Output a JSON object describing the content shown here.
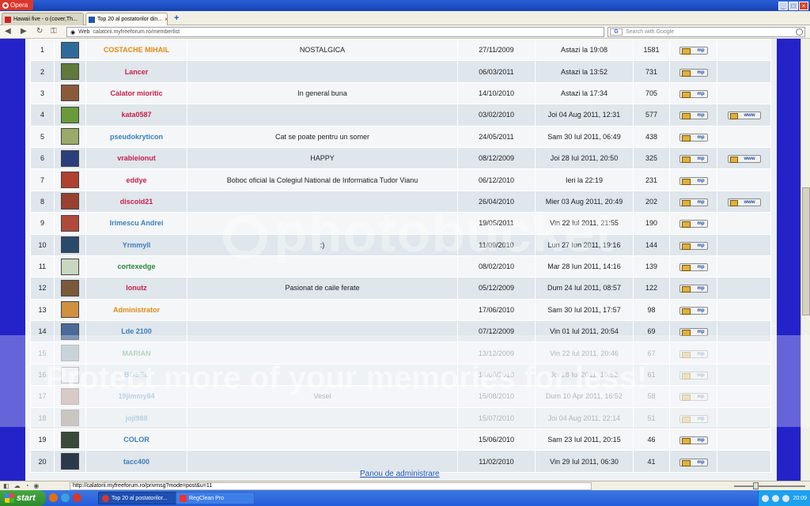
{
  "window": {
    "menu_label": "Opera",
    "minimize": "_",
    "maximize": "□",
    "close": "×"
  },
  "tabs": [
    {
      "label": "Hawaii five - o (cover,Th...",
      "fav_color": "#cc2222"
    },
    {
      "label": "Top 20 al postatorilor din...",
      "fav_color": "#2255aa"
    }
  ],
  "tab_close": "×",
  "new_tab": "+",
  "address": {
    "web_label": "Web",
    "url": "calatorii.myfreeforum.ro/memberlist"
  },
  "search": {
    "engine": "G",
    "placeholder": "Search with Google"
  },
  "rows": [
    {
      "rank": "1",
      "username": "COSTACHE MIHAIL",
      "color": "#e08a16",
      "motto": "NOSTALGICA",
      "joined": "27/11/2009",
      "last_visit": "Astazi la 19:08",
      "posts": "1581",
      "www": false,
      "faded": false,
      "avatar": "#2f6b9a"
    },
    {
      "rank": "2",
      "username": "Lancer",
      "color": "#c8204a",
      "motto": "",
      "joined": "06/03/2011",
      "last_visit": "Astazi la 13:52",
      "posts": "731",
      "www": false,
      "faded": false,
      "avatar": "#5f7a3a"
    },
    {
      "rank": "3",
      "username": "Calator mioritic",
      "color": "#c8204a",
      "motto": "In general buna",
      "joined": "14/10/2010",
      "last_visit": "Astazi la 17:34",
      "posts": "705",
      "www": false,
      "faded": false,
      "avatar": "#8a5a3a"
    },
    {
      "rank": "4",
      "username": "kata0587",
      "color": "#c8204a",
      "motto": "",
      "joined": "03/02/2010",
      "last_visit": "Joi 04 Aug 2011, 12:31",
      "posts": "577",
      "www": true,
      "faded": false,
      "avatar": "#6a9a3a"
    },
    {
      "rank": "5",
      "username": "pseudokryticon",
      "color": "#3a7fb8",
      "motto": "Cat se poate pentru un somer",
      "joined": "24/05/2011",
      "last_visit": "Sam 30 Iul 2011, 06:49",
      "posts": "438",
      "www": false,
      "faded": false,
      "avatar": "#9aaa6a"
    },
    {
      "rank": "6",
      "username": "vrabieionut",
      "color": "#c8204a",
      "motto": "HAPPY",
      "joined": "08/12/2009",
      "last_visit": "Joi 28 Iul 2011, 20:50",
      "posts": "325",
      "www": true,
      "faded": false,
      "avatar": "#2a3f7a"
    },
    {
      "rank": "7",
      "username": "eddye",
      "color": "#c8204a",
      "motto": "Boboc oficial la Colegiul National de Informatica Tudor Vianu",
      "joined": "06/12/2010",
      "last_visit": "Ieri la 22:19",
      "posts": "231",
      "www": false,
      "faded": false,
      "avatar": "#b04030"
    },
    {
      "rank": "8",
      "username": "discoid21",
      "color": "#c8204a",
      "motto": "",
      "joined": "26/04/2010",
      "last_visit": "Mier 03 Aug 2011, 20:49",
      "posts": "202",
      "www": true,
      "faded": false,
      "avatar": "#9a4030"
    },
    {
      "rank": "9",
      "username": "Irimescu Andrei",
      "color": "#3a7fb8",
      "motto": "",
      "joined": "19/05/2011",
      "last_visit": "Vin 22 Iul 2011, 21:55",
      "posts": "190",
      "www": false,
      "faded": false,
      "avatar": "#b04a3a"
    },
    {
      "rank": "10",
      "username": "Yrmmyll",
      "color": "#3a7fb8",
      "motto": ":)",
      "joined": "11/09/2010",
      "last_visit": "Lun 27 Iun 2011, 19:16",
      "posts": "144",
      "www": false,
      "faded": false,
      "avatar": "#2a4a6a"
    },
    {
      "rank": "11",
      "username": "cortexedge",
      "color": "#2a8a3a",
      "motto": "",
      "joined": "08/02/2010",
      "last_visit": "Mar 28 Iun 2011, 14:16",
      "posts": "139",
      "www": false,
      "faded": false,
      "avatar": "#c8d8c0"
    },
    {
      "rank": "12",
      "username": "Ionutz",
      "color": "#c8204a",
      "motto": "Pasionat de caile ferate",
      "joined": "05/12/2009",
      "last_visit": "Dum 24 Iul 2011, 08:57",
      "posts": "122",
      "www": false,
      "faded": false,
      "avatar": "#7a5a3a"
    },
    {
      "rank": "13",
      "username": "Administrator",
      "color": "#e08a16",
      "motto": "",
      "joined": "17/06/2010",
      "last_visit": "Sam 30 Iul 2011, 17:57",
      "posts": "98",
      "www": false,
      "faded": false,
      "avatar": "#d09040"
    },
    {
      "rank": "14",
      "username": "Lde 2100",
      "color": "#3a7fb8",
      "motto": "",
      "joined": "07/12/2009",
      "last_visit": "Vin 01 Iul 2011, 20:54",
      "posts": "69",
      "www": false,
      "faded": false,
      "avatar": "#4a6a9a"
    },
    {
      "rank": "15",
      "username": "MARIAN",
      "color": "#2a8a3a",
      "motto": "",
      "joined": "13/12/2009",
      "last_visit": "Vin 22 Iul 2011, 20:46",
      "posts": "67",
      "www": false,
      "faded": true,
      "avatar": "#6a8a9a"
    },
    {
      "rank": "16",
      "username": "BOSEL",
      "color": "#3a7fb8",
      "motto": "",
      "joined": "14/06/2010",
      "last_visit": "Joi 28 Iul 2011, 18:52",
      "posts": "61",
      "www": false,
      "faded": true,
      "avatar": "#e8e8f0"
    },
    {
      "rank": "17",
      "username": "19jimmy84",
      "color": "#3a7fb8",
      "motto": "Vesel",
      "joined": "15/08/2010",
      "last_visit": "Dum 10 Apr 2011, 16:52",
      "posts": "58",
      "www": false,
      "faded": true,
      "avatar": "#9a6a5a"
    },
    {
      "rank": "18",
      "username": "joji988",
      "color": "#3a7fb8",
      "motto": "",
      "joined": "15/07/2010",
      "last_visit": "Joi 04 Aug 2011, 22:14",
      "posts": "51",
      "www": false,
      "faded": true,
      "avatar": "#6a5a4a"
    },
    {
      "rank": "19",
      "username": "COLOR",
      "color": "#3a7fb8",
      "motto": "",
      "joined": "15/06/2010",
      "last_visit": "Sam 23 Iul 2011, 20:15",
      "posts": "46",
      "www": false,
      "faded": false,
      "avatar": "#3a4a3a"
    },
    {
      "rank": "20",
      "username": "tacc400",
      "color": "#3a7fb8",
      "motto": "",
      "joined": "11/02/2010",
      "last_visit": "Vin 29 Iul 2011, 06:30",
      "posts": "41",
      "www": false,
      "faded": false,
      "avatar": "#2a3a4a"
    }
  ],
  "pm_label": "mp",
  "www_label": "www",
  "admin_link": "Panou de administrare",
  "watermark": {
    "logo": "photobucket",
    "text": "Protect more of your memories for less!"
  },
  "status": {
    "url": "http://calatorii.myfreeforum.ro/privmsg?mode=post&u=11"
  },
  "taskbar": {
    "start": "start",
    "items": [
      {
        "label": "Top 20 al postatorilor...",
        "active": true
      },
      {
        "label": "RegClean Pro",
        "active": false
      }
    ],
    "clock": "20:09"
  }
}
